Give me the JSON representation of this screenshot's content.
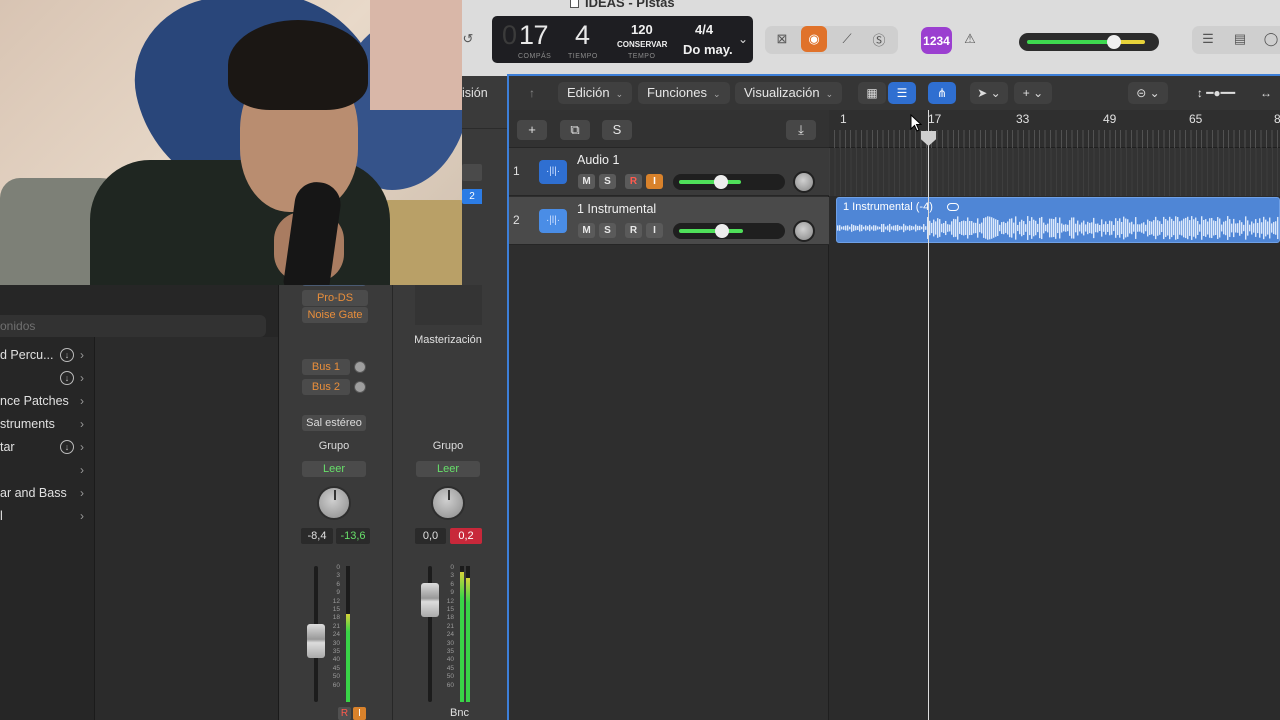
{
  "window": {
    "title": "IDEAS - Pistas"
  },
  "lcd": {
    "bar": "17",
    "beat": "4",
    "bar_label": "COMPÁS",
    "beat_label": "TIEMPO",
    "tempo": "120",
    "tempo_mode": "CONSERVAR",
    "tempo_label": "TEMPO",
    "signature": "4/4",
    "key": "Do may."
  },
  "toolbar": {
    "count_in_label": "1234"
  },
  "inspector": {
    "header_fragment": "isión",
    "slot_number": "2",
    "plugins": [
      "Pro-DS",
      "Noise Gate"
    ],
    "master_label": "Masterización",
    "sends": [
      "Bus 1",
      "Bus 2"
    ],
    "output": "Sal estéreo",
    "group_label": "Grupo",
    "automation": "Leer",
    "strip1": {
      "volume": "-8,4",
      "peak": "-13,6",
      "rec": "R",
      "input": "I"
    },
    "strip2": {
      "volume": "0,0",
      "peak": "0,2",
      "name": "Bnc"
    },
    "meter_scale": [
      "0",
      "3",
      "6",
      "9",
      "12",
      "15",
      "18",
      "21",
      "24",
      "30",
      "35",
      "40",
      "45",
      "50",
      "60"
    ]
  },
  "library": {
    "search_placeholder": "onidos",
    "items": [
      {
        "label": "d Percu...",
        "download": true
      },
      {
        "label": "",
        "download": true
      },
      {
        "label": "nce Patches",
        "download": false
      },
      {
        "label": "struments",
        "download": false
      },
      {
        "label": "tar",
        "download": true
      },
      {
        "label": "",
        "download": false
      },
      {
        "label": "ar and Bass",
        "download": false
      },
      {
        "label": "l",
        "download": false
      }
    ]
  },
  "tracks_toolbar": {
    "menus": [
      "Edición",
      "Funciones",
      "Visualización"
    ],
    "header_buttons": {
      "add": "+",
      "duplicate": "⧉",
      "solo": "S"
    }
  },
  "ruler": {
    "marks": [
      "1",
      "17",
      "33",
      "49",
      "65"
    ]
  },
  "tracks": [
    {
      "number": "1",
      "name": "Audio 1",
      "mute": "M",
      "solo": "S",
      "record": "R",
      "input": "I",
      "volume": 0.5
    },
    {
      "number": "2",
      "name": "1 Instrumental",
      "mute": "M",
      "solo": "S",
      "record": "R",
      "input": "I",
      "volume": 0.5
    }
  ],
  "regions": [
    {
      "track": 2,
      "name": "1 Instrumental (-4)"
    }
  ],
  "colors": {
    "accent": "#2f6fd1",
    "region": "#4f86d6",
    "meter": "#39d447",
    "orange": "#e0722a"
  }
}
